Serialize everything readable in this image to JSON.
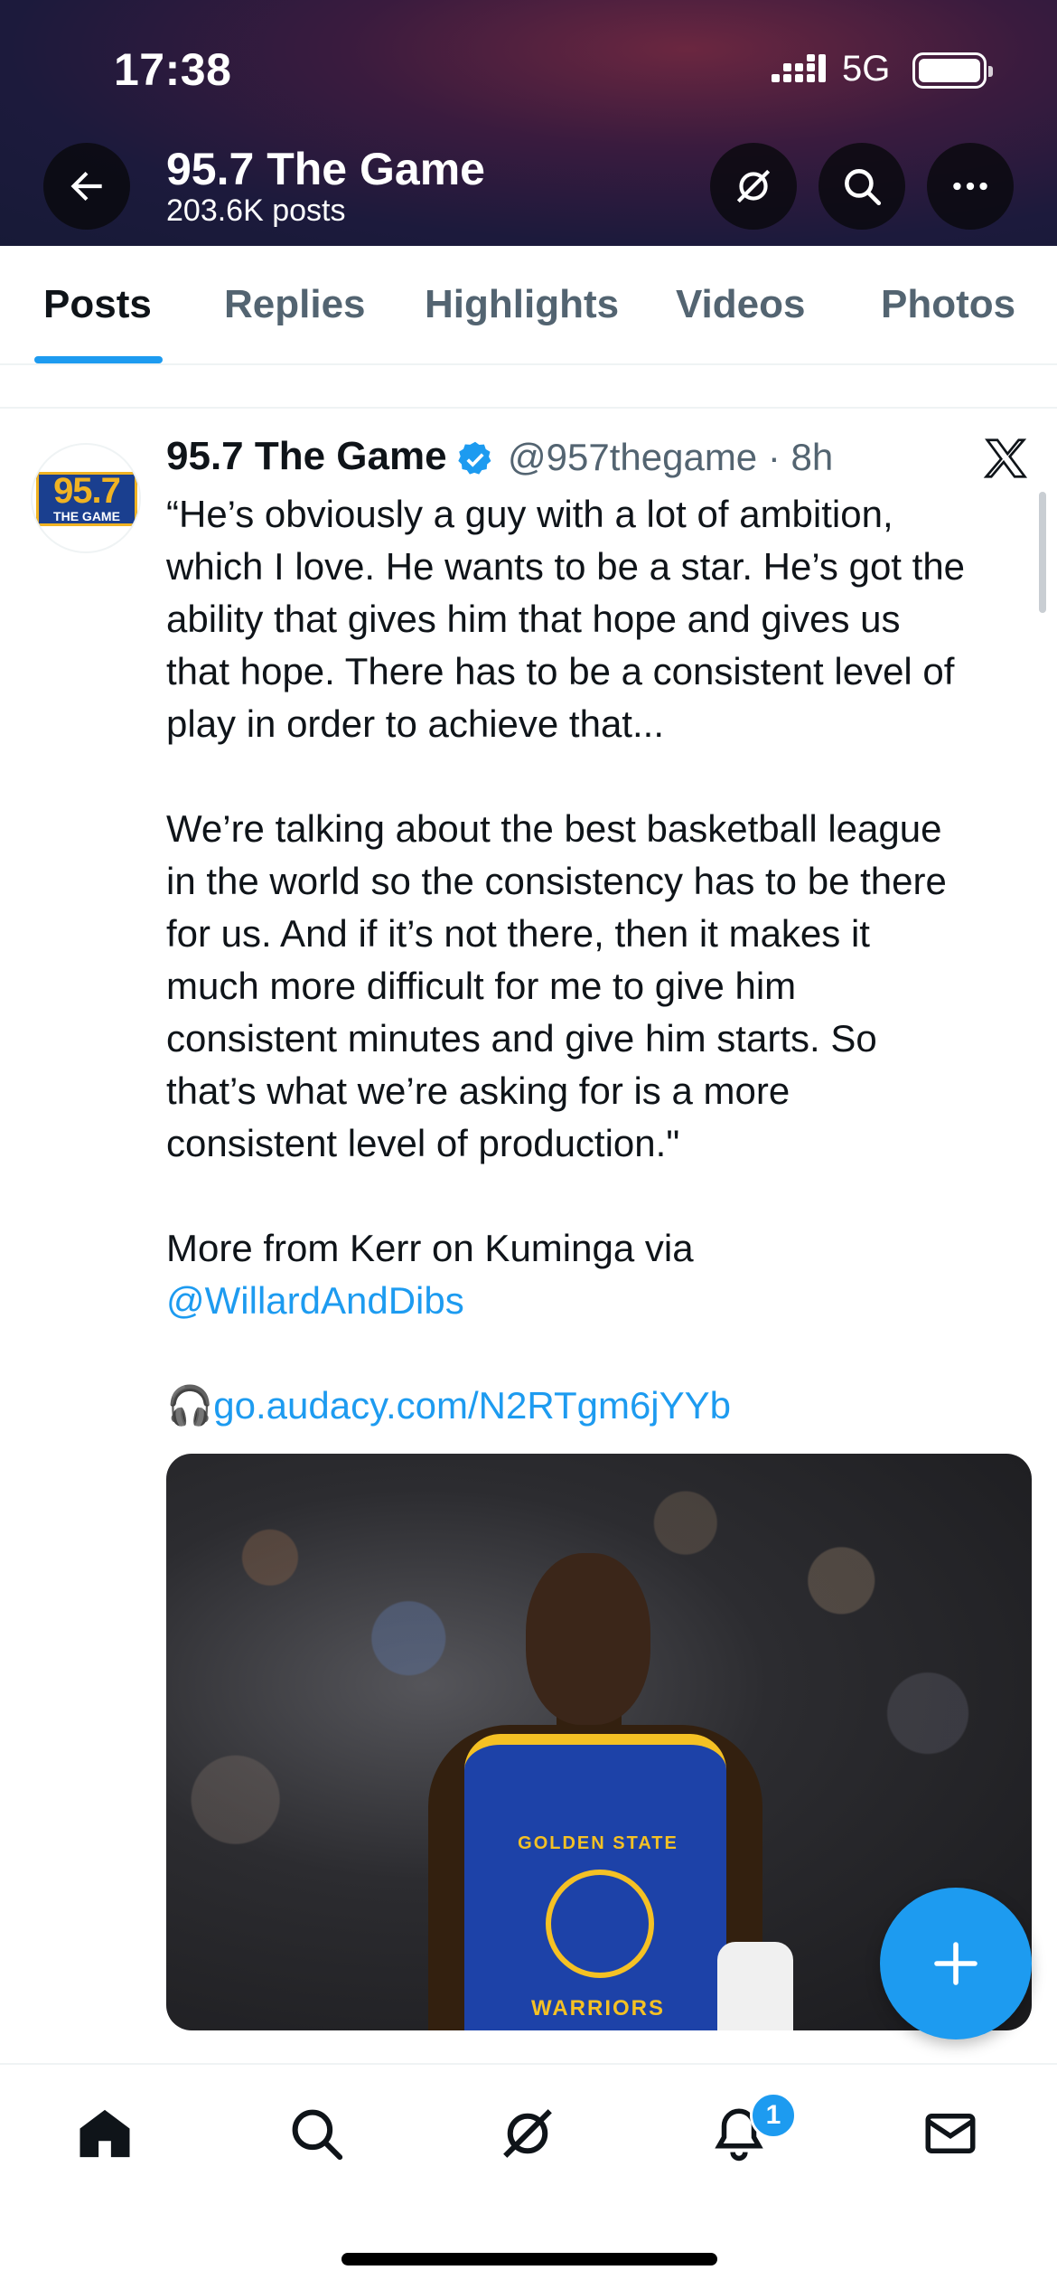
{
  "status_bar": {
    "time": "17:38",
    "network": "5G"
  },
  "header": {
    "title": "95.7 The Game",
    "post_count": "203.6K posts",
    "icons": [
      "back-arrow-icon",
      "grok-icon",
      "search-icon",
      "more-icon"
    ]
  },
  "tabs": [
    {
      "label": "Posts",
      "active": true
    },
    {
      "label": "Replies",
      "active": false
    },
    {
      "label": "Highlights",
      "active": false
    },
    {
      "label": "Videos",
      "active": false
    },
    {
      "label": "Photos",
      "active": false
    }
  ],
  "tweet": {
    "author_name": "95.7 The Game",
    "handle_time": "@957thegame · 8h",
    "avatar_logo_number": "95.7",
    "avatar_logo_text": "THE GAME",
    "paragraph1": "“He’s obviously a guy with a lot of ambition,\nwhich I love. He wants to be a star. He’s got the\nability that gives him that hope and gives us\nthat hope. There has to be a consistent level of\nplay in order to achieve that...",
    "paragraph2": "We’re talking about the best basketball league\nin the world so the consistency has to be there\nfor us. And if it’s not there, then it makes it\nmuch more difficult for me to give him\nconsistent minutes and give him starts. So\nthat’s what we’re asking for is a more\nconsistent level of production.\"",
    "paragraph3_prefix": "More from Kerr on Kuminga via",
    "mention": "@WillardAndDibs",
    "headphone_emoji": "🎧",
    "link": "go.audacy.com/N2RTgm6jYYb",
    "image_jersey_top": "GOLDEN STATE",
    "image_jersey_bottom": "WARRIORS"
  },
  "bottom_nav": {
    "items": [
      "home-icon",
      "search-icon",
      "grok-icon",
      "notifications-icon",
      "messages-icon"
    ],
    "notification_count": "1"
  },
  "colors": {
    "accent": "#1d9bf0",
    "text": "#0f1419",
    "secondary": "#536471"
  }
}
